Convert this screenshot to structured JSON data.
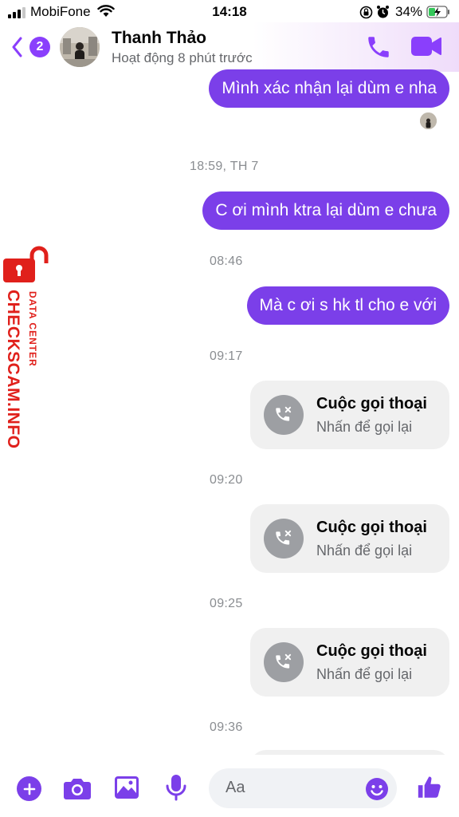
{
  "status_bar": {
    "carrier": "MobiFone",
    "time": "14:18",
    "battery": "34%"
  },
  "header": {
    "unread_count": "2",
    "contact_name": "Thanh Thảo",
    "contact_status": "Hoạt động 8 phút trước",
    "accent_color": "#8a3ffc"
  },
  "messages": [
    {
      "type": "outgoing",
      "text": "Mình xác nhận lại dùm e nha"
    },
    {
      "type": "timestamp",
      "text": "18:59, TH 7"
    },
    {
      "type": "outgoing",
      "text": "C ơi mình ktra lại dùm e chưa"
    },
    {
      "type": "timestamp",
      "text": "08:46"
    },
    {
      "type": "outgoing",
      "text": "Mà c ơi s hk tl cho e với"
    },
    {
      "type": "timestamp",
      "text": "09:17"
    },
    {
      "type": "call",
      "title": "Cuộc gọi thoại",
      "subtitle": "Nhấn để gọi lại"
    },
    {
      "type": "timestamp",
      "text": "09:20"
    },
    {
      "type": "call",
      "title": "Cuộc gọi thoại",
      "subtitle": "Nhấn để gọi lại"
    },
    {
      "type": "timestamp",
      "text": "09:25"
    },
    {
      "type": "call",
      "title": "Cuộc gọi thoại",
      "subtitle": "Nhấn để gọi lại"
    },
    {
      "type": "timestamp",
      "text": "09:36"
    }
  ],
  "watermark": {
    "brand": "CHECKSCAM.INFO",
    "subtitle": "DATA CENTER"
  },
  "composer": {
    "placeholder": "Aa"
  },
  "colors": {
    "outgoing_bubble": "#7b3fe9",
    "call_card": "#f0f0f0",
    "watermark": "#e0201b"
  },
  "icons": [
    "back-chevron-icon",
    "phone-icon",
    "video-call-icon",
    "missed-call-icon",
    "plus-icon",
    "camera-icon",
    "gallery-icon",
    "microphone-icon",
    "emoji-icon",
    "thumbs-up-icon"
  ]
}
